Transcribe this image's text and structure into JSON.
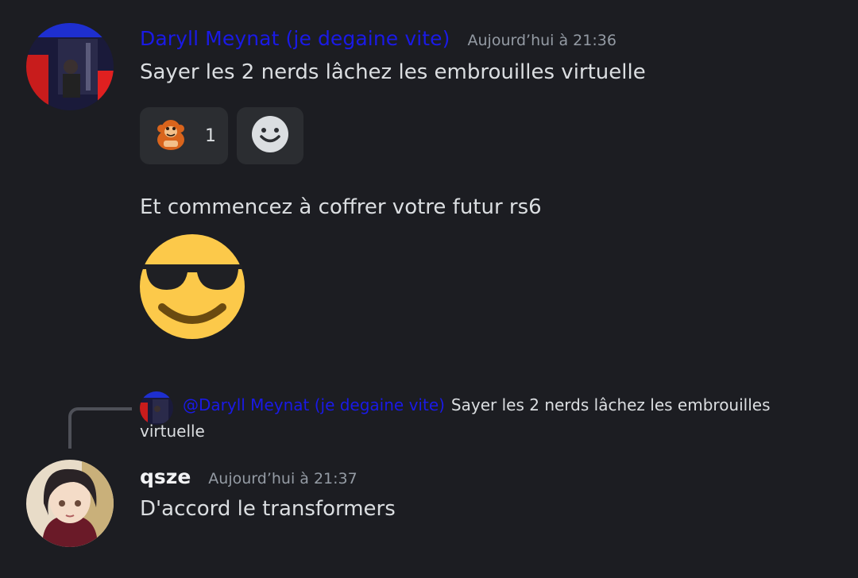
{
  "messages": [
    {
      "author": "Daryll Meynat (je degaine vite)",
      "timestamp": "Aujourd’hui à 21:36",
      "text": "Sayer les 2 nerds lâchez les embrouilles virtuelle",
      "reactions": [
        {
          "emoji": "monkey-emoji",
          "count": "1"
        }
      ],
      "add_reaction_icon": "smile-add-reaction-icon"
    },
    {
      "text": "Et commencez à coffrer votre futur rs6",
      "emoji": "sunglasses-face-emoji"
    },
    {
      "author": "qsze",
      "timestamp": "Aujourd’hui à 21:37",
      "text": "D'accord le transformers",
      "reply": {
        "mention": "@Daryll Meynat (je degaine vite)",
        "text": "Sayer les 2 nerds lâchez les embrouilles virtuelle"
      }
    }
  ],
  "colors": {
    "background": "#1c1d22",
    "username_accent": "#1a1ae6",
    "reaction_bg": "#2b2d31",
    "timestamp": "#949ba4"
  }
}
